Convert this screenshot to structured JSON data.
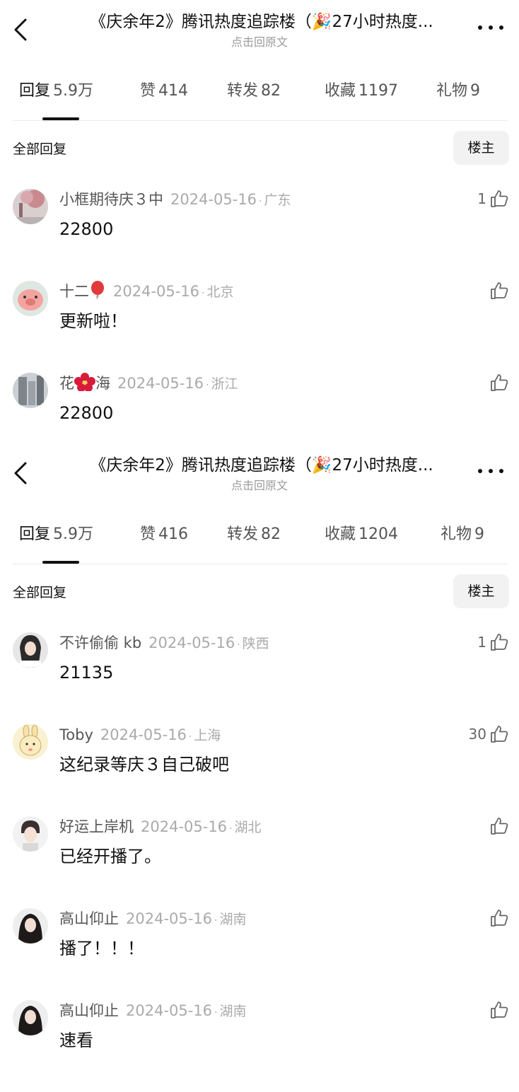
{
  "panels": [
    {
      "title": "《庆余年2》腾讯热度追踪楼（🎉27小时热度...",
      "subtitle": "点击回原文",
      "tabs": [
        {
          "label": "回复",
          "count": "5.9万"
        },
        {
          "label": "赞",
          "count": "414"
        },
        {
          "label": "转发",
          "count": "82"
        },
        {
          "label": "收藏",
          "count": "1197"
        },
        {
          "label": "礼物",
          "count": "9"
        }
      ],
      "all_replies_label": "全部回复",
      "owner_button": "楼主",
      "comments": [
        {
          "name": "小框期待庆３中",
          "date": "2024-05-16",
          "location": "广东",
          "text": "22800",
          "likes": "1",
          "avatar": "tree-photo"
        },
        {
          "name": "十二",
          "name_emoji": "balloon",
          "date": "2024-05-16",
          "location": "北京",
          "text": "更新啦！",
          "likes": "",
          "avatar": "pink-pig"
        },
        {
          "name": "花",
          "name_emoji": "hibiscus",
          "name_suffix": "海",
          "date": "2024-05-16",
          "location": "浙江",
          "text": "22800",
          "likes": "",
          "avatar": "building-photo"
        }
      ]
    },
    {
      "title": "《庆余年2》腾讯热度追踪楼（🎉27小时热度...",
      "subtitle": "点击回原文",
      "tabs": [
        {
          "label": "回复",
          "count": "5.9万"
        },
        {
          "label": "赞",
          "count": "416"
        },
        {
          "label": "转发",
          "count": "82"
        },
        {
          "label": "收藏",
          "count": "1204"
        },
        {
          "label": "礼物",
          "count": "9"
        }
      ],
      "all_replies_label": "全部回复",
      "owner_button": "楼主",
      "comments": [
        {
          "name": "不许偷偷 kb",
          "date": "2024-05-16",
          "location": "陕西",
          "text": "21135",
          "likes": "1",
          "avatar": "girl-photo"
        },
        {
          "name": "Toby",
          "date": "2024-05-16",
          "location": "上海",
          "text": "这纪录等庆３自己破吧",
          "likes": "30",
          "avatar": "bunny-cartoon"
        },
        {
          "name": "好运上岸机",
          "date": "2024-05-16",
          "location": "湖北",
          "text": "已经开播了。",
          "likes": "",
          "avatar": "boy-photo"
        },
        {
          "name": "高山仰止",
          "date": "2024-05-16",
          "location": "湖南",
          "text": "播了！！！",
          "likes": "",
          "avatar": "girl-dark-photo"
        },
        {
          "name": "高山仰止",
          "date": "2024-05-16",
          "location": "湖南",
          "text": "速看",
          "likes": "",
          "avatar": "girl-dark-photo"
        }
      ]
    }
  ]
}
